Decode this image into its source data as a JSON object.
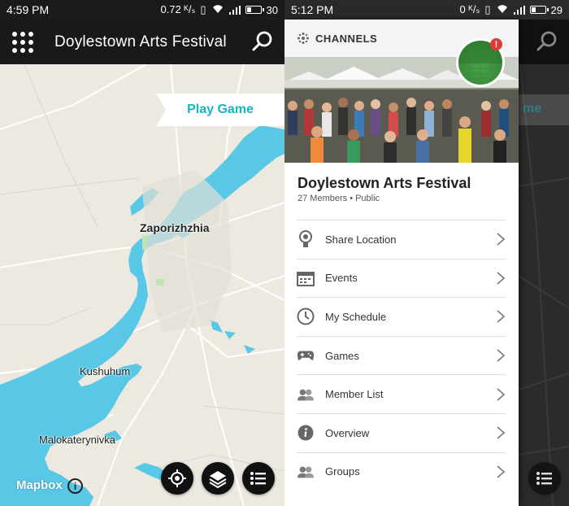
{
  "left": {
    "status": {
      "time": "4:59 PM",
      "speed": "0.72 ᴷ/ₛ",
      "battery": "30"
    },
    "app_title": "Doylestown Arts Festival",
    "play_game_label": "Play Game",
    "map_labels": {
      "city": "Zaporizhzhia",
      "town1": "Kushuhum",
      "town2": "Malokaterynivka"
    },
    "attribution": "Mapbox",
    "info_glyph": "i",
    "colors": {
      "water": "#59c7e6",
      "land": "#ece9e0",
      "accent": "#16b5c4",
      "bar": "#191919"
    }
  },
  "right": {
    "status": {
      "time": "5:12 PM",
      "speed": "0 ᴷ/ₛ",
      "battery": "29"
    },
    "channels_label": "CHANNELS",
    "group_title": "Doylestown Arts Festival",
    "group_sub": "27 Members • Public",
    "notification_glyph": "!",
    "behind_play": "me",
    "menu": [
      {
        "label": "Share Location",
        "icon": "location-pin-icon"
      },
      {
        "label": "Events",
        "icon": "calendar-icon"
      },
      {
        "label": "My Schedule",
        "icon": "clock-icon"
      },
      {
        "label": "Games",
        "icon": "gamepad-icon"
      },
      {
        "label": "Member List",
        "icon": "people-icon"
      },
      {
        "label": "Overview",
        "icon": "info-icon"
      },
      {
        "label": "Groups",
        "icon": "groups-icon"
      }
    ]
  }
}
